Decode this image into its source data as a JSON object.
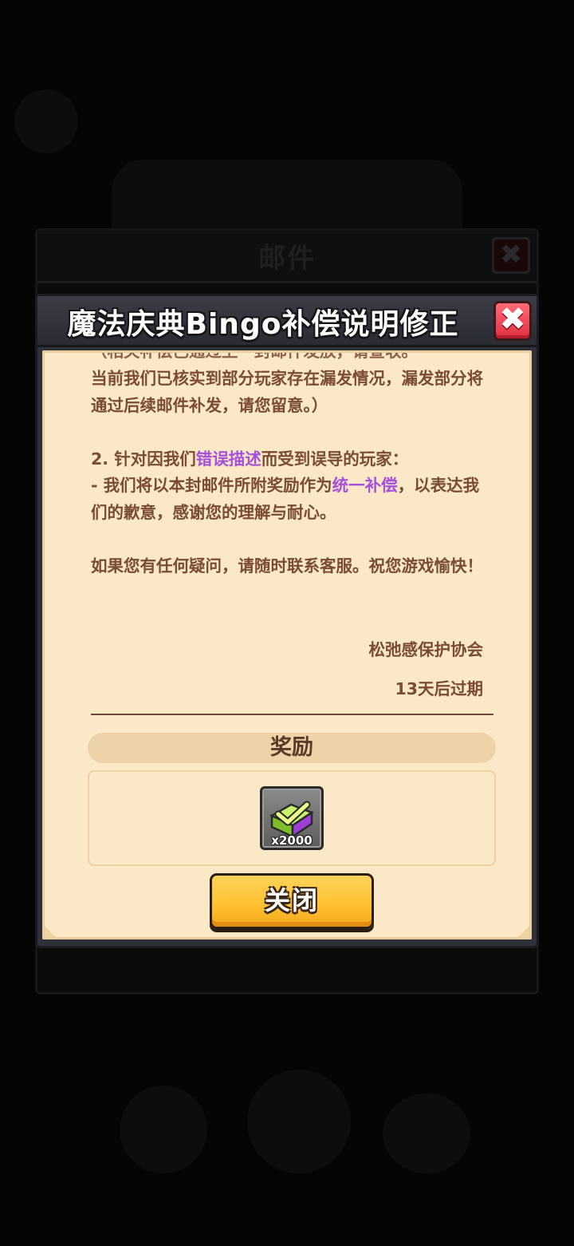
{
  "background_mail": {
    "title": "邮件",
    "close_label": "✖"
  },
  "dialog": {
    "title": "魔法庆典Bingo补偿说明修正",
    "close_label": "✖",
    "body": {
      "cut_line": "（相关补偿已通过上一封邮件发放，请查收。",
      "para1": "当前我们已核实到部分玩家存在漏发情况，漏发部分将通过后续邮件补发，请您留意。）",
      "item2_prefix": "2. 针对因我们",
      "item2_highlight": "错误描述",
      "item2_suffix": "而受到误导的玩家：",
      "item2_line2_prefix": "- 我们将以本封邮件所附奖励作为",
      "item2_line2_highlight": "统一补偿",
      "item2_line2_suffix": "，以表达我们的歉意，感谢您的理解与耐心。",
      "para3": "如果您有任何疑问，请随时联系客服。祝您游戏愉快！"
    },
    "signature": "松弛感保护协会",
    "expiry": "13天后过期",
    "reward_header": "奖励",
    "reward": {
      "icon": "green-purple-gem-icon",
      "count": "x2000"
    },
    "button_label": "关闭"
  },
  "colors": {
    "highlight": "#a64fd9",
    "text": "#7a4c31",
    "paper": "#fae8c7",
    "button": "#ffc232",
    "close_red": "#e0303f"
  }
}
